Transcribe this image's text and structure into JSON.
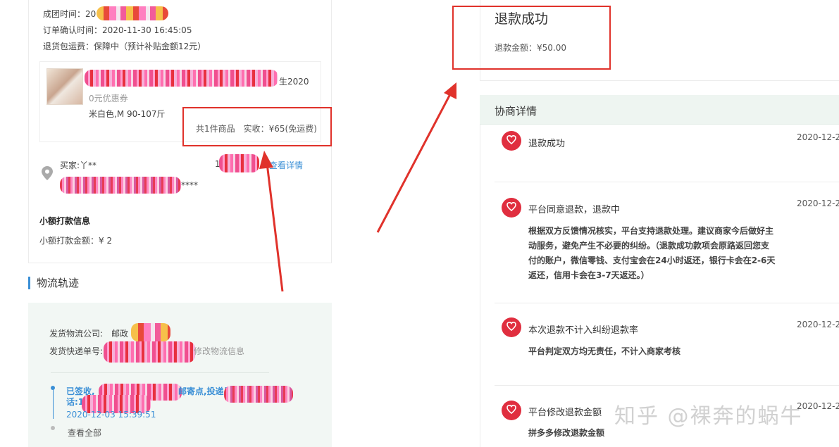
{
  "order": {
    "group_time_label": "成团时间：20",
    "confirm_time": "订单确认时间：2020-11-30 16:45:05",
    "return_shipping": "退货包运费：保障中（预计补贴金额12元）",
    "product": {
      "name_suffix": "生2020",
      "coupon": "0元优惠券",
      "spec": "米白色,M 90-107斤",
      "summary": "共1件商品　实收：¥65(免运费)"
    },
    "buyer": {
      "label": "买家:丫**",
      "num_prefix": "1",
      "masked_suffix": "****",
      "detail_link": "查看详情"
    },
    "small_payment": {
      "title": "小额打款信息",
      "amount": "小额打款金额：¥ 2"
    }
  },
  "logistics": {
    "title": "物流轨迹",
    "company_label": "发货物流公司:　邮政",
    "tracking_label": "发货快递单号:",
    "modify_link": "修改物流信息",
    "latest_status_line1": "已签收,",
    "latest_status_mid": "邮寄点,投递员",
    "latest_status_line2": "话:1",
    "latest_time": "2020-12-03 15:39:51",
    "view_all": "查看全部"
  },
  "refund": {
    "title": "退款成功",
    "amount": "退款金额：¥50.00"
  },
  "negotiation": {
    "title": "协商详情",
    "events": [
      {
        "title": "退款成功",
        "time": "2020-12-2",
        "desc": []
      },
      {
        "title": "平台同意退款，退款中",
        "time": "2020-12-2",
        "desc": [
          "根据双方反馈情况核实，平台支持退款处理。建议商家今后做好主",
          "动服务，避免产生不必要的纠纷。（退款成功款项会原路返回您支",
          "付的账户，微信零钱、支付宝会在24小时返还，银行卡会在2-6天",
          "返还，信用卡会在3-7天返还。）"
        ]
      },
      {
        "title": "本次退款不计入纠纷退款率",
        "time": "2020-12-2",
        "desc": [
          "平台判定双方均无责任，不计入商家考核"
        ]
      },
      {
        "title": "平台修改退款金额",
        "time": "2020-12-2",
        "desc": [
          "拼多多修改退款金额"
        ]
      }
    ]
  },
  "watermark": "知乎 @裸奔的蜗牛",
  "colors": {
    "accent_blue": "#3a8fd6",
    "annotation_red": "#e0322b",
    "logo_red": "#e02e3f"
  }
}
